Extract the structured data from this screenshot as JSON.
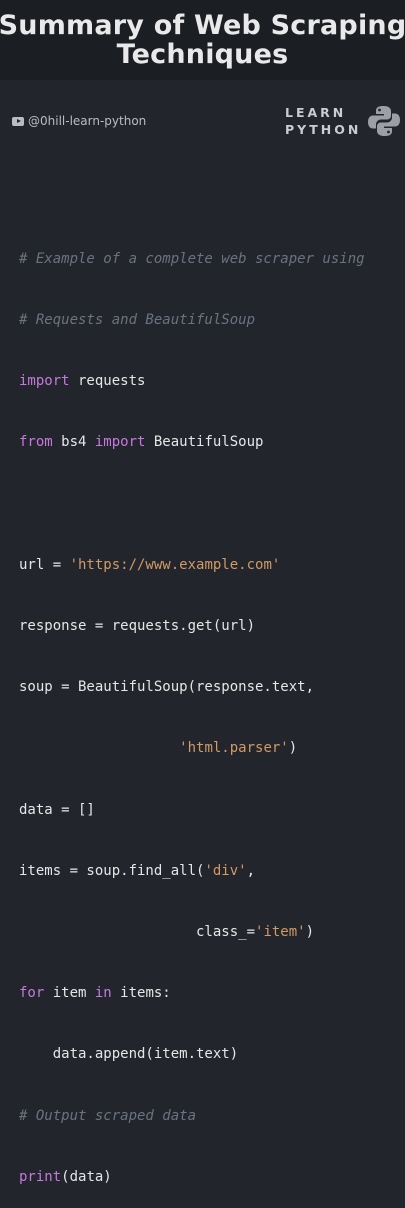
{
  "header": {
    "title_line1": "Summary of Web Scraping",
    "title_line2": "Techniques"
  },
  "channel": {
    "icon": "youtube-icon",
    "handle": "@0hill-learn-python"
  },
  "brand": {
    "line1": "LEARN",
    "line2": "PYTHON",
    "logo": "python-logo-icon"
  },
  "code": {
    "l1": "# Example of a complete web scraper using",
    "l2": "# Requests and BeautifulSoup",
    "l3_kw": "import",
    "l3_rest": " requests",
    "l4_kw1": "from",
    "l4_mid": " bs4 ",
    "l4_kw2": "import",
    "l4_rest": " BeautifulSoup",
    "l6_pre": "url = ",
    "l6_str": "'https://www.example.com'",
    "l7": "response = requests.get(url)",
    "l8": "soup = BeautifulSoup(response.text,",
    "l9_pad": "                   ",
    "l9_str": "'html.parser'",
    "l9_post": ")",
    "l10": "data = []",
    "l11_pre": "items = soup.find_all(",
    "l11_str": "'div'",
    "l11_post": ",",
    "l12_pad": "                     class_=",
    "l12_str": "'item'",
    "l12_post": ")",
    "l13_kw1": "for",
    "l13_mid": " item ",
    "l13_kw2": "in",
    "l13_rest": " items:",
    "l14": "    data.append(item.text)",
    "l15": "# Output scraped data",
    "l16_kw": "print",
    "l16_rest": "(data)"
  },
  "colors": {
    "background": "#22252b",
    "header_bg": "#1b1e23",
    "keyword": "#c678dd",
    "string": "#d19a66",
    "comment": "#6b7280"
  }
}
